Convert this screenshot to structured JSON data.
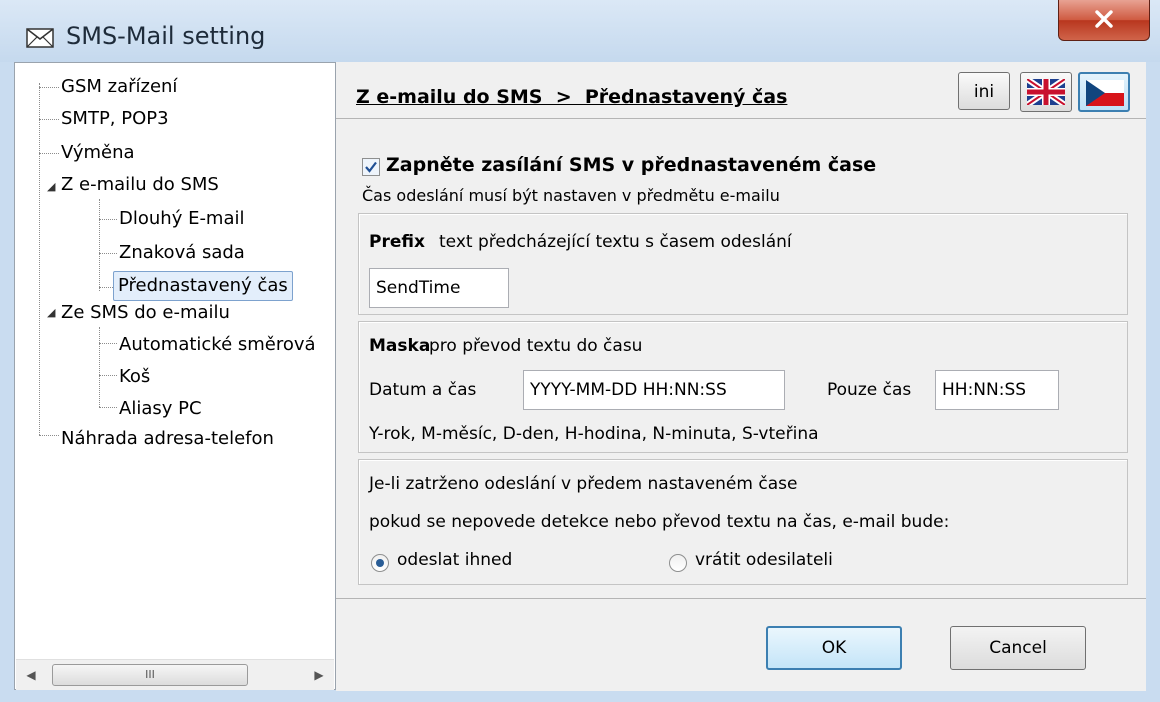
{
  "window": {
    "title": "SMS-Mail setting",
    "icon": "envelope-icon",
    "close_label": "X"
  },
  "tree": {
    "items": [
      {
        "label": "GSM zařízení",
        "level": 0
      },
      {
        "label": "SMTP, POP3",
        "level": 0
      },
      {
        "label": "Výměna",
        "level": 0
      },
      {
        "label": "Z e-mailu do SMS",
        "level": 0,
        "expanded": true
      },
      {
        "label": "Dlouhý E-mail",
        "level": 1
      },
      {
        "label": "Znaková sada",
        "level": 1
      },
      {
        "label": "Přednastavený čas",
        "level": 1,
        "selected": true
      },
      {
        "label": "Ze SMS do e-mailu",
        "level": 0,
        "expanded": true
      },
      {
        "label": "Automatické směrová",
        "level": 1
      },
      {
        "label": "Koš",
        "level": 1
      },
      {
        "label": "Aliasy PC",
        "level": 1
      },
      {
        "label": "Náhrada adresa-telefon",
        "level": 0
      }
    ],
    "scroll_thumb": "III"
  },
  "header": {
    "breadcrumb": "Z e-mailu do SMS  >  Přednastavený čas",
    "ini_label": "ini",
    "flags": [
      "uk-flag-icon",
      "czech-flag-icon"
    ]
  },
  "settings": {
    "enable_checked": true,
    "enable_label": "Zapněte zasílání SMS v přednastaveném čase",
    "enable_note": "Čas odeslání musí být nastaven v předmětu e-mailu",
    "prefix_title": "Prefix",
    "prefix_desc": "text předcházející textu s časem odeslání",
    "prefix_value": "SendTime",
    "mask_title": "Maska",
    "mask_desc": "pro převod textu do času",
    "datetime_label": "Datum a čas",
    "datetime_value": "YYYY-MM-DD HH:NN:SS",
    "time_label": "Pouze čas",
    "time_value": "HH:NN:SS",
    "mask_legend": "Y-rok, M-měsíc, D-den, H-hodina, N-minuta, S-vteřina",
    "fail_line1": "Je-li zatrženo odeslání v předem nastaveném čase",
    "fail_line2": "pokud se nepovede detekce nebo převod textu na čas, e-mail bude:",
    "option_send_now": "odeslat ihned",
    "option_return": "vrátit odesilateli",
    "selected_option": "odeslat ihned"
  },
  "buttons": {
    "ok": "OK",
    "cancel": "Cancel"
  }
}
